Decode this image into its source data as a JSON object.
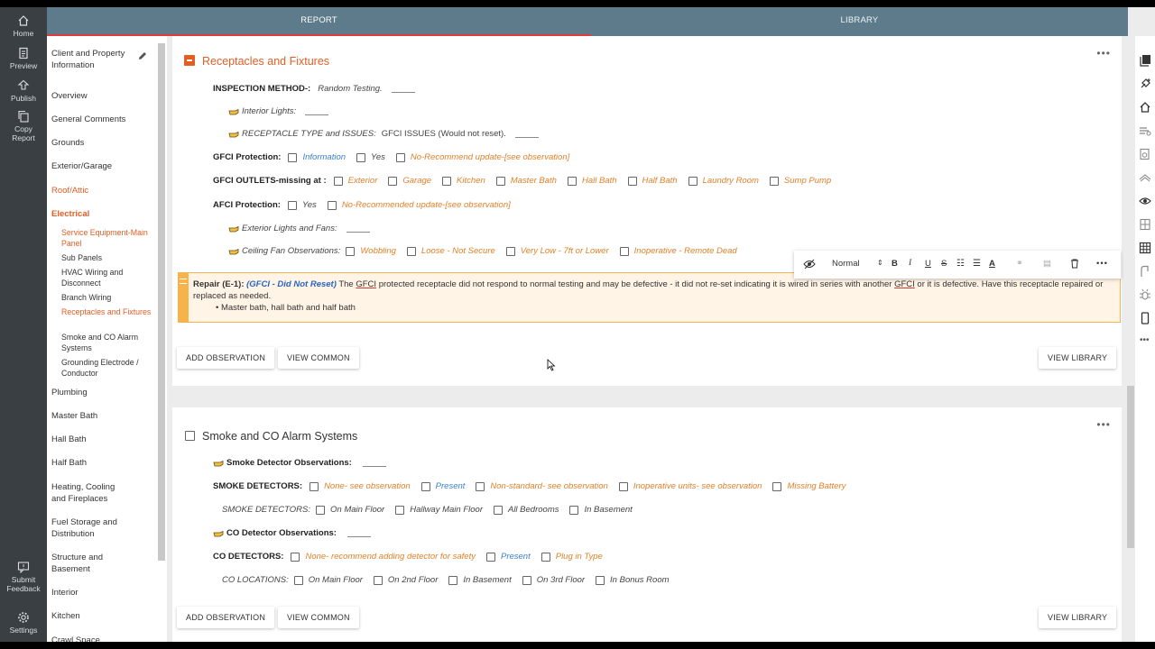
{
  "rail": {
    "home": "Home",
    "preview": "Preview",
    "publish": "Publish",
    "copy_report": "Copy Report",
    "submit_feedback": "Submit Feedback",
    "settings": "Settings"
  },
  "tabs": {
    "report": "REPORT",
    "library": "LIBRARY"
  },
  "nav": {
    "client": "Client and Property Information",
    "overview": "Overview",
    "general_comments": "General Comments",
    "grounds": "Grounds",
    "exterior_garage": "Exterior/Garage",
    "roof_attic": "Roof/Attic",
    "electrical": "Electrical",
    "sub_service": "Service Equipment-Main Panel",
    "sub_panels": "Sub Panels",
    "sub_hvac": "HVAC Wiring and Disconnect",
    "sub_branch": "Branch Wiring",
    "sub_receptacles": "Receptacles and Fixtures",
    "sub_smoke": "Smoke and CO Alarm Systems",
    "sub_grounding": "Grounding Electrode / Conductor",
    "plumbing": "Plumbing",
    "master_bath": "Master Bath",
    "hall_bath": "Hall Bath",
    "half_bath": "Half Bath",
    "heating": "Heating, Cooling and Fireplaces",
    "fuel": "Fuel Storage and Distribution",
    "structure": "Structure and Basement",
    "interior": "Interior",
    "kitchen": "Kitchen",
    "crawl": "Crawl Space"
  },
  "section1": {
    "title": "Receptacles and Fixtures",
    "inspection_label": "INSPECTION METHOD-:",
    "inspection_value": "Random Testing.",
    "interior_lights": "Interior Lights:",
    "receptacle_label": "RECEPTACLE TYPE and ISSUES:",
    "receptacle_value": "GFCI ISSUES (Would not reset).",
    "gfci_protection": {
      "label": "GFCI Protection:",
      "options": [
        "Information",
        "Yes",
        "No-Recommend update-[see observation]"
      ]
    },
    "gfci_outlets": {
      "label": "GFCI OUTLETS-missing at :",
      "options": [
        "Exterior",
        "Garage",
        "Kitchen",
        "Master Bath",
        "Hall Bath",
        "Half Bath",
        "Laundry Room",
        "Sump Pump"
      ]
    },
    "afci_protection": {
      "label": "AFCI Protection:",
      "options": [
        "Yes",
        "No-Recommended update-[see observation]"
      ]
    },
    "exterior_lights": "Exterior Lights and Fans:",
    "ceiling_fan": {
      "label": "Ceiling Fan Observations:",
      "options": [
        "Wobbling",
        "Loose - Not Secure",
        "Very Low - 7ft or Lower",
        "Inoperative - Remote Dead"
      ]
    },
    "repair": {
      "title": "Repair (E-1):",
      "subtitle": "(GFCI - Did Not Reset)",
      "text_a": "The",
      "gfci_word": "GFCI",
      "text_b": "protected receptacle did not respond to normal testing and may be defective - it did not re-set indicating it is wired in series with another",
      "text_c": "or it is defective. Have this receptacle repaired or replaced as needed.",
      "bullet": "Master bath, hall bath and half bath"
    },
    "toolbar": {
      "format": "Normal"
    },
    "add_observation": "ADD OBSERVATION",
    "view_common": "VIEW COMMON",
    "view_library": "VIEW LIBRARY"
  },
  "section2": {
    "title": "Smoke and CO Alarm Systems",
    "smoke_obs": "Smoke Detector Observations:",
    "smoke_detectors": {
      "label": "SMOKE DETECTORS:",
      "options": [
        "None- see observation",
        "Present",
        "Non-standard- see observation",
        "Inoperative units- see observation",
        "Missing Battery"
      ]
    },
    "smoke_locations": {
      "label": "SMOKE DETECTORS:",
      "options": [
        "On Main Floor",
        "Hallway Main Floor",
        "All Bedrooms",
        "In Basement"
      ]
    },
    "co_obs": "CO Detector Observations:",
    "co_detectors": {
      "label": "CO DETECTORS:",
      "options": [
        "None- recommend adding detector for safety",
        "Present",
        "Plug in Type"
      ]
    },
    "co_locations": {
      "label": "CO LOCATIONS:",
      "options": [
        "On Main Floor",
        "On 2nd Floor",
        "In Basement",
        "On 3rd Floor",
        "In Bonus Room"
      ]
    },
    "add_observation": "ADD OBSERVATION",
    "view_common": "VIEW COMMON",
    "view_library": "VIEW LIBRARY"
  },
  "colors": {
    "rail": "#3a3f44",
    "topbar": "#5d7b8a",
    "accent_orange": "#e35d25",
    "option_orange": "#e0822a",
    "option_blue": "#3b7fd0",
    "repair_bg": "#fff4e6",
    "repair_border": "#f7b24a"
  }
}
